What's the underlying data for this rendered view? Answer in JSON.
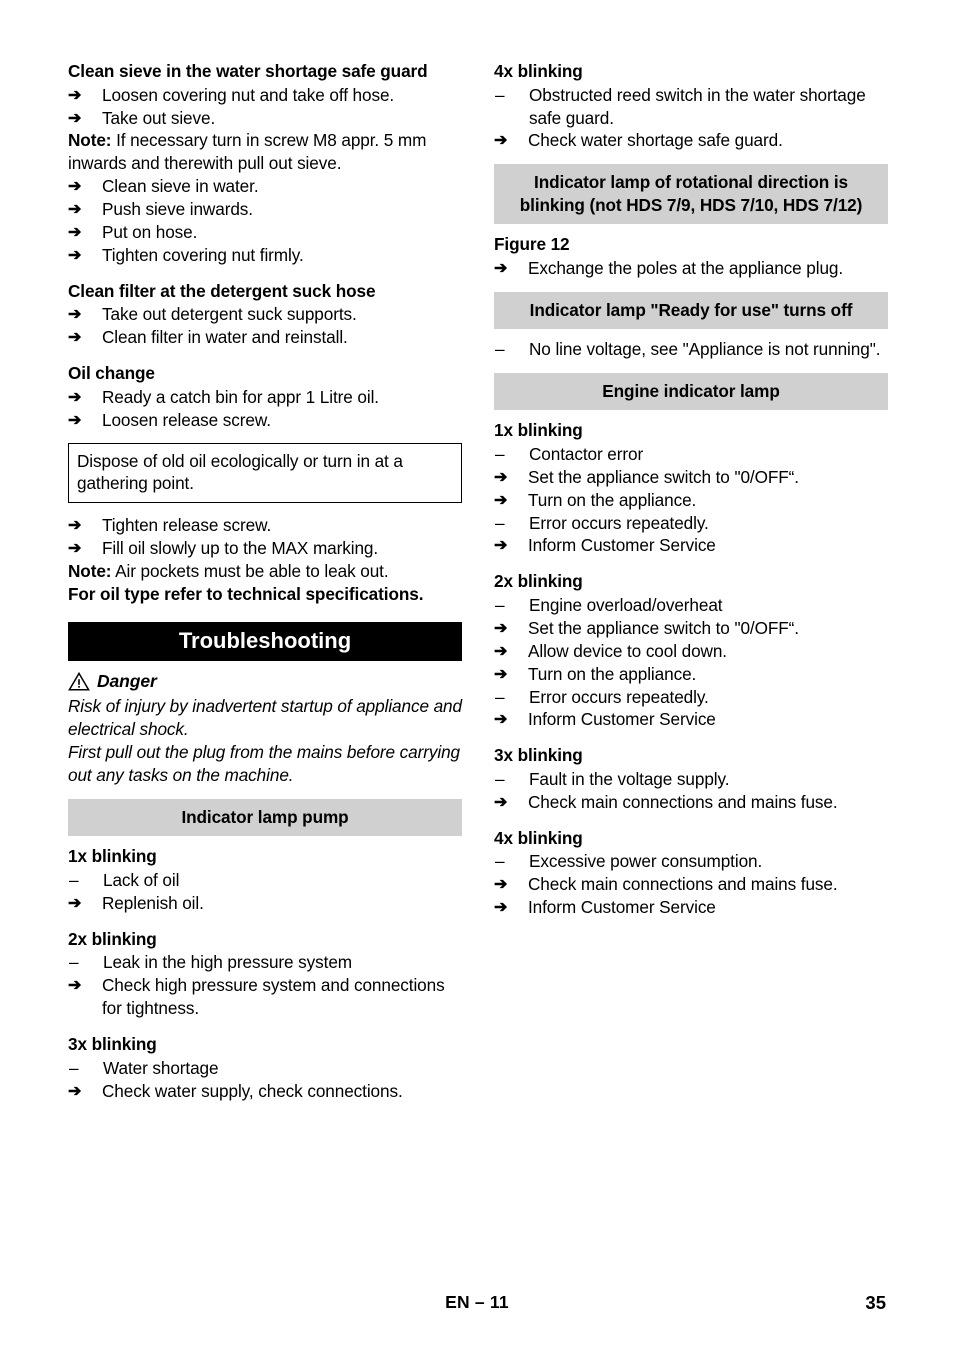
{
  "document": {
    "footer_center": "EN – 11",
    "footer_page": "35",
    "colors": {
      "heading_bar_gray": "#d0d0d0",
      "section_bar_black": "#000000",
      "text": "#000000",
      "page_background": "#ffffff"
    }
  },
  "left_column": {
    "sections": [
      {
        "heading": "Clean sieve in the water shortage safe guard",
        "items": [
          {
            "marker": "arrow",
            "text": "Loosen covering nut and take off hose."
          },
          {
            "marker": "arrow",
            "text": "Take out sieve."
          }
        ],
        "note_label": "Note:",
        "note_text": " If necessary turn in screw M8 appr. 5 mm inwards and therewith pull out sieve.",
        "items_after": [
          {
            "marker": "arrow",
            "text": "Clean sieve in water."
          },
          {
            "marker": "arrow",
            "text": "Push sieve inwards."
          },
          {
            "marker": "arrow",
            "text": "Put on hose."
          },
          {
            "marker": "arrow",
            "text": "Tighten covering nut firmly."
          }
        ]
      },
      {
        "heading": "Clean filter at the detergent suck hose",
        "items": [
          {
            "marker": "arrow",
            "text": "Take out detergent suck supports."
          },
          {
            "marker": "arrow",
            "text": "Clean filter in water and reinstall."
          }
        ]
      },
      {
        "heading": "Oil change",
        "items": [
          {
            "marker": "arrow",
            "text": "Ready a catch bin for appr 1 Litre oil."
          },
          {
            "marker": "arrow",
            "text": "Loosen release screw."
          }
        ],
        "boxed_note": "Dispose of old oil ecologically or turn in at a gathering point.",
        "items_after": [
          {
            "marker": "arrow",
            "text": "Tighten release screw."
          },
          {
            "marker": "arrow",
            "text": "Fill oil slowly up to the MAX marking."
          }
        ],
        "note_label": "Note:",
        "note_text": " Air pockets must be able to leak out.",
        "note_bold_tail": "For oil type refer to technical specifications."
      }
    ],
    "troubleshooting": {
      "bar_title": "Troubleshooting",
      "danger_icon": "warning-triangle-icon",
      "danger_word": "Danger",
      "danger_text_1": "Risk of injury by inadvertent startup of appliance and electrical shock.",
      "danger_text_2": "First pull out the plug from the mains before carrying out any tasks on the machine."
    },
    "indicator_lamp_pump": {
      "bar_title": "Indicator lamp pump",
      "groups": [
        {
          "label": "1x blinking",
          "items": [
            {
              "marker": "dash",
              "text": "Lack of oil"
            },
            {
              "marker": "arrow",
              "text": "Replenish oil."
            }
          ]
        },
        {
          "label": "2x blinking",
          "items": [
            {
              "marker": "dash",
              "text": "Leak in the high pressure system"
            },
            {
              "marker": "arrow",
              "text": "Check high pressure system and connections for tightness."
            }
          ]
        },
        {
          "label": "3x blinking",
          "items": [
            {
              "marker": "dash",
              "text": "Water shortage"
            },
            {
              "marker": "arrow",
              "text": "Check water supply, check connections."
            }
          ]
        }
      ]
    }
  },
  "right_column": {
    "pump_continued": {
      "label": "4x blinking",
      "items": [
        {
          "marker": "dash",
          "text": "Obstructed reed switch in the water shortage safe guard."
        },
        {
          "marker": "arrow",
          "text": "Check water shortage safe guard."
        }
      ]
    },
    "rotational_direction": {
      "bar_title": "Indicator lamp of rotational direction is blinking (not HDS 7/9, HDS 7/10, HDS 7/12)",
      "figure_label": "Figure 12",
      "items": [
        {
          "marker": "arrow",
          "text": "Exchange the poles at the appliance plug."
        }
      ]
    },
    "ready_for_use": {
      "bar_title": "Indicator lamp \"Ready for use\" turns off",
      "items": [
        {
          "marker": "dash",
          "text": "No line voltage, see \"Appliance is not running\"."
        }
      ]
    },
    "engine_indicator_lamp": {
      "bar_title": "Engine indicator lamp",
      "groups": [
        {
          "label": "1x blinking",
          "items": [
            {
              "marker": "dash",
              "text": "Contactor error"
            },
            {
              "marker": "arrow",
              "text": "Set the appliance switch to \"0/OFF“."
            },
            {
              "marker": "arrow",
              "text": "Turn on the appliance."
            },
            {
              "marker": "dash",
              "text": "Error occurs repeatedly."
            },
            {
              "marker": "arrow",
              "text": "Inform Customer Service"
            }
          ]
        },
        {
          "label": "2x blinking",
          "items": [
            {
              "marker": "dash",
              "text": "Engine overload/overheat"
            },
            {
              "marker": "arrow",
              "text": "Set the appliance switch to \"0/OFF“."
            },
            {
              "marker": "arrow",
              "text": "Allow device to cool down."
            },
            {
              "marker": "arrow",
              "text": "Turn on the appliance."
            },
            {
              "marker": "dash",
              "text": "Error occurs repeatedly."
            },
            {
              "marker": "arrow",
              "text": "Inform Customer Service"
            }
          ]
        },
        {
          "label": "3x blinking",
          "items": [
            {
              "marker": "dash",
              "text": "Fault in the voltage supply."
            },
            {
              "marker": "arrow",
              "text": "Check main connections and mains fuse."
            }
          ]
        },
        {
          "label": "4x blinking",
          "items": [
            {
              "marker": "dash",
              "text": "Excessive power consumption."
            },
            {
              "marker": "arrow",
              "text": "Check main connections and mains fuse."
            },
            {
              "marker": "arrow",
              "text": "Inform Customer Service"
            }
          ]
        }
      ]
    }
  },
  "glyphs": {
    "arrow": "➔",
    "dash": "–"
  }
}
